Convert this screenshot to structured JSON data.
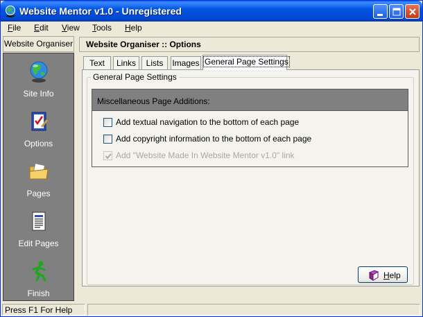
{
  "window": {
    "title": "Website Mentor v1.0 - Unregistered",
    "app_icon": "globe-icon",
    "controls": [
      "minimize-icon",
      "maximize-icon",
      "close-icon"
    ]
  },
  "menu": {
    "items": [
      {
        "key": "F",
        "rest": "ile"
      },
      {
        "key": "E",
        "rest": "dit"
      },
      {
        "key": "V",
        "rest": "iew"
      },
      {
        "key": "T",
        "rest": "ools"
      },
      {
        "key": "H",
        "rest": "elp"
      }
    ]
  },
  "sidebar": {
    "header": "Website Organiser",
    "items": [
      {
        "label": "Site Info",
        "icon": "globe-icon"
      },
      {
        "label": "Options",
        "icon": "checklist-icon"
      },
      {
        "label": "Pages",
        "icon": "folder-icon"
      },
      {
        "label": "Edit Pages",
        "icon": "document-icon"
      },
      {
        "label": "Finish",
        "icon": "runner-icon"
      }
    ]
  },
  "main": {
    "header": "Website Organiser :: Options",
    "tabs": [
      {
        "label": "Text"
      },
      {
        "label": "Links"
      },
      {
        "label": "Lists"
      },
      {
        "label": "Images"
      },
      {
        "label": "General Page Settings"
      }
    ],
    "active_tab": "General Page Settings",
    "group_title": "General Page Settings",
    "misc": {
      "header": "Miscellaneous Page Additions:",
      "options": [
        {
          "label": "Add textual navigation to the bottom of each page",
          "checked": false,
          "enabled": true
        },
        {
          "label": "Add copyright information to the bottom of each page",
          "checked": false,
          "enabled": true
        },
        {
          "label": "Add \"Website Made In Website Mentor v1.0\" link",
          "checked": true,
          "enabled": false
        }
      ]
    },
    "help_button": {
      "key": "H",
      "rest": "elp",
      "icon": "help-book-icon"
    }
  },
  "status": {
    "text": "Press F1 For Help",
    "second_pane": ""
  },
  "colors": {
    "titlebar": "#0247D2",
    "sidebar_bg": "#808080",
    "misc_header_bg": "#808080",
    "face": "#ECE9D8"
  }
}
